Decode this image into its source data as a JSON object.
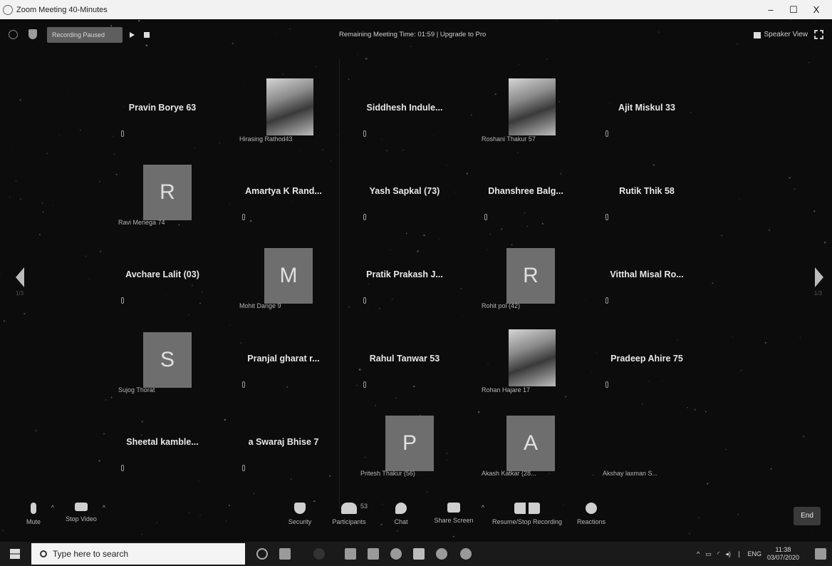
{
  "window": {
    "title": "Zoom Meeting 40-Minutes",
    "controls": [
      "–",
      "☐",
      "X"
    ]
  },
  "topbar": {
    "recording_label": "Recording Paused",
    "remaining_text": "Remaining Meeting Time: 01:59 | Upgrade to Pro",
    "speaker_view_label": "Speaker View"
  },
  "tiles": [
    {
      "name": "Pravin Borye 63",
      "type": "name"
    },
    {
      "name": "Hirasing Rathod43",
      "type": "photo"
    },
    {
      "name": "Siddhesh  Indule...",
      "type": "name"
    },
    {
      "name": "Roshani Thakur 57",
      "type": "photo"
    },
    {
      "name": "Ajit Miskul 33",
      "type": "name"
    },
    {
      "name": "Ravi Menega 74",
      "type": "avatar",
      "letter": "R"
    },
    {
      "name": "Amartya K Rand...",
      "type": "name"
    },
    {
      "name": "Yash Sapkal (73)",
      "type": "name"
    },
    {
      "name": "Dhanshree  Balg...",
      "type": "name"
    },
    {
      "name": "Rutik Thik 58",
      "type": "name"
    },
    {
      "name": "Avchare Lalit (03)",
      "type": "name"
    },
    {
      "name": "Mohit Dange 9",
      "type": "avatar",
      "letter": "M"
    },
    {
      "name": "Pratik Prakash J...",
      "type": "name"
    },
    {
      "name": "Rohit pol (42)",
      "type": "avatar",
      "letter": "R"
    },
    {
      "name": "Vitthal Misal Ro...",
      "type": "name"
    },
    {
      "name": "Sujog Thorat",
      "type": "avatar",
      "letter": "S"
    },
    {
      "name": "Pranjal gharat r...",
      "type": "name"
    },
    {
      "name": "Rahul Tanwar 53",
      "type": "name"
    },
    {
      "name": "Rohan Hajare 17",
      "type": "photo"
    },
    {
      "name": "Pradeep Ahire 75",
      "type": "name"
    },
    {
      "name": "Sheetal  kamble...",
      "type": "name"
    },
    {
      "name": "a Swaraj Bhise 7",
      "type": "name"
    },
    {
      "name": "Pritesh Thakur (56)",
      "type": "avatar",
      "letter": "P"
    },
    {
      "name": "Akash Katkar (28...",
      "type": "avatar",
      "letter": "A"
    },
    {
      "name": "Akshay laxman S...",
      "type": "sub"
    }
  ],
  "pager": {
    "left": "1/3",
    "right": "1/3"
  },
  "controls": {
    "mute": "Mute",
    "stop_video": "Stop Video",
    "security": "Security",
    "participants": "Participants",
    "participants_count": "53",
    "chat": "Chat",
    "share_screen": "Share Screen",
    "resume_stop_recording": "Resume/Stop Recording",
    "reactions": "Reactions",
    "end": "End"
  },
  "taskbar": {
    "search_placeholder": "Type here to search",
    "lang": "ENG",
    "time": "11:38",
    "date": "03/07/2020"
  },
  "colors": {
    "meeting_bg": "#0c0c0c",
    "avatar_bg": "#6e6e6e",
    "titlebar_bg": "#f2f2f2",
    "taskbar_bg": "#1a1a1a"
  }
}
